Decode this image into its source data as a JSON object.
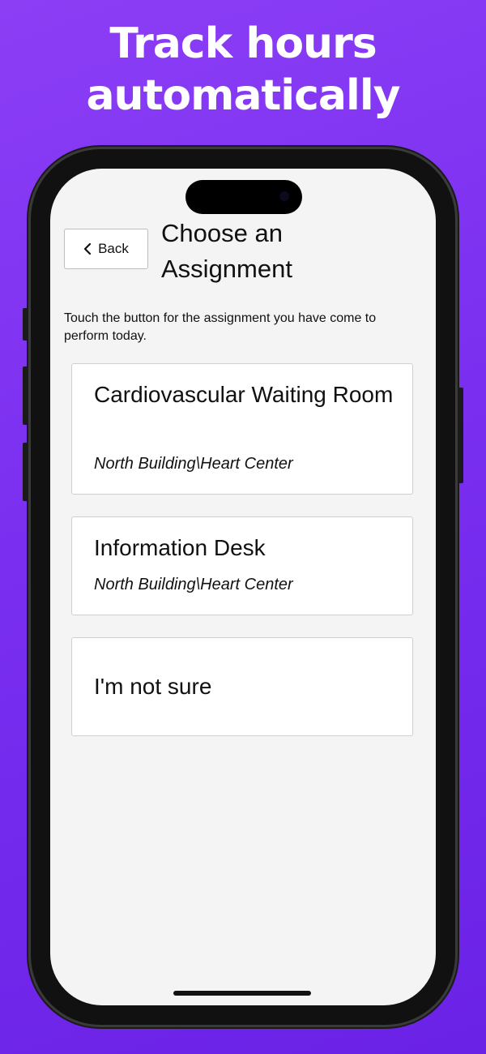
{
  "headline": {
    "line1": "Track hours",
    "line2": "automatically"
  },
  "header": {
    "back_label": "Back",
    "title": "Choose an Assignment"
  },
  "instructions": "Touch the button for the assignment you have come to perform today.",
  "assignments": [
    {
      "title": "Cardiovascular Waiting Room",
      "location": "North Building\\Heart Center"
    },
    {
      "title": "Information Desk",
      "location": "North Building\\Heart Center"
    },
    {
      "title": "I'm not sure",
      "location": ""
    }
  ],
  "colors": {
    "background_gradient_start": "#8c3ef5",
    "background_gradient_end": "#6a22e6",
    "screen_background": "#f4f4f4",
    "card_background": "#ffffff",
    "card_border": "#cfcfcf"
  },
  "icons": {
    "back": "chevron-left-icon"
  }
}
